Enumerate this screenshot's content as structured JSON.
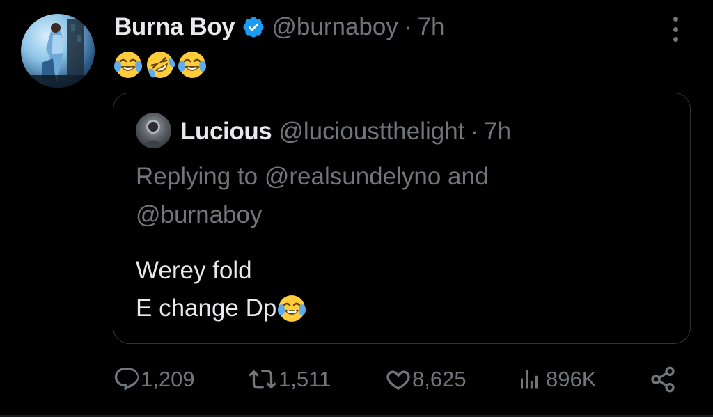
{
  "tweet": {
    "author_name": "Burna Boy",
    "author_handle": "@burnaboy",
    "separator": "·",
    "time": "7h",
    "text_emojis": [
      "joy-emoji",
      "rofl-emoji",
      "joy-emoji"
    ]
  },
  "quote": {
    "author_name": "Lucious",
    "author_handle": "@lucioustthelight",
    "separator": "·",
    "time": "7h",
    "reply_prefix": "Replying to",
    "reply_mention_1": "@realsundelyno",
    "reply_and": "and",
    "reply_mention_2": "@burnaboy",
    "body_line_1": "Werey fold",
    "body_line_2": "E change Dp"
  },
  "actions": {
    "replies": "1,209",
    "reposts": "1,511",
    "likes": "8,625",
    "views": "896K"
  },
  "colors": {
    "background": "#000000",
    "text_primary": "#e7e9ea",
    "text_secondary": "#71767b",
    "verified_badge": "#1d9bf0",
    "border": "#2f3336",
    "emoji_yellow": "#ffcc3e"
  }
}
